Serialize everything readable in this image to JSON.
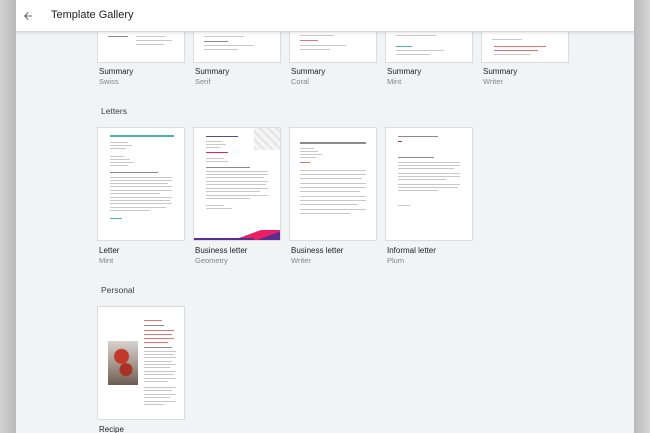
{
  "window": {
    "title": "Template Gallery"
  },
  "colors": {
    "accent_mint": "#26a69a",
    "accent_coral": "#e57373",
    "accent_pink": "#e91e63",
    "accent_purple": "#5c2d91"
  },
  "summary_row": [
    {
      "title": "Summary",
      "subtitle": "Swiss"
    },
    {
      "title": "Summary",
      "subtitle": "Serif"
    },
    {
      "title": "Summary",
      "subtitle": "Coral"
    },
    {
      "title": "Summary",
      "subtitle": "Mint"
    },
    {
      "title": "Summary",
      "subtitle": "Writer"
    }
  ],
  "sections": {
    "letters": {
      "label": "Letters",
      "items": [
        {
          "title": "Letter",
          "subtitle": "Mint"
        },
        {
          "title": "Business letter",
          "subtitle": "Geometry"
        },
        {
          "title": "Business letter",
          "subtitle": "Writer"
        },
        {
          "title": "Informal letter",
          "subtitle": "Plum"
        }
      ]
    },
    "personal": {
      "label": "Personal",
      "items": [
        {
          "title": "Recipe"
        }
      ]
    }
  }
}
